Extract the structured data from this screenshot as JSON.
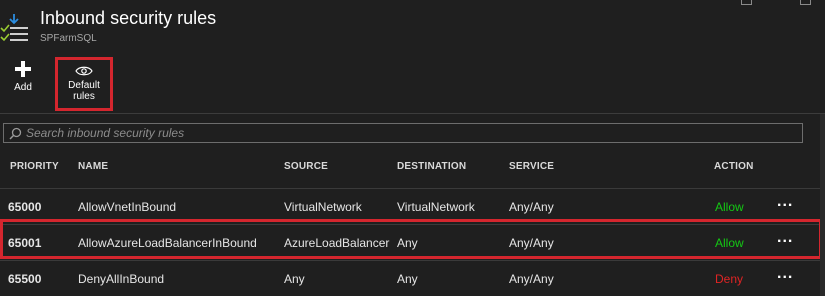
{
  "header": {
    "title": "Inbound security rules",
    "subtitle": "SPFarmSQL"
  },
  "commands": {
    "add": {
      "label": "Add",
      "icon": "plus-icon"
    },
    "default_rules": {
      "label_line1": "Default",
      "label_line2": "rules",
      "icon": "eye-icon"
    }
  },
  "search": {
    "placeholder": "Search inbound security rules",
    "icon": "search-icon"
  },
  "table": {
    "columns": [
      "PRIORITY",
      "NAME",
      "SOURCE",
      "DESTINATION",
      "SERVICE",
      "ACTION"
    ],
    "rows": [
      {
        "priority": "65000",
        "name": "AllowVnetInBound",
        "source": "VirtualNetwork",
        "destination": "VirtualNetwork",
        "service": "Any/Any",
        "action": "Allow",
        "more": "..."
      },
      {
        "priority": "65001",
        "name": "AllowAzureLoadBalancerInBound",
        "source": "AzureLoadBalancer",
        "destination": "Any",
        "service": "Any/Any",
        "action": "Allow",
        "more": "..."
      },
      {
        "priority": "65500",
        "name": "DenyAllInBound",
        "source": "Any",
        "destination": "Any",
        "service": "Any/Any",
        "action": "Deny",
        "more": "..."
      }
    ]
  },
  "colors": {
    "background": "#1f1f1f",
    "highlight": "#d4262e",
    "allow": "#14c914",
    "deny": "#e02424"
  }
}
